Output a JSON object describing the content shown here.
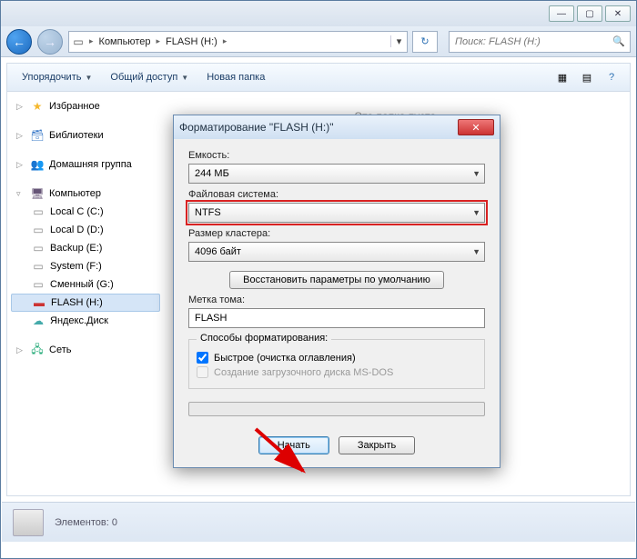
{
  "addressbar": {
    "crumb1": "Компьютер",
    "crumb2": "FLASH (H:)"
  },
  "search": {
    "placeholder": "Поиск: FLASH (H:)"
  },
  "toolbar": {
    "organize": "Упорядочить",
    "share": "Общий доступ",
    "newfolder": "Новая папка"
  },
  "sidebar": {
    "favorites": "Избранное",
    "libraries": "Библиотеки",
    "homegroup": "Домашняя группа",
    "computer": "Компьютер",
    "drives": [
      "Local C (C:)",
      "Local D (D:)",
      "Backup (E:)",
      "System (F:)",
      "Сменный (G:)",
      "FLASH (H:)",
      "Яндекс.Диск"
    ],
    "network": "Сеть"
  },
  "content": {
    "empty": "Эта папка пуста."
  },
  "status": {
    "elements": "Элементов: 0"
  },
  "dialog": {
    "title": "Форматирование \"FLASH (H:)\"",
    "capacity_label": "Емкость:",
    "capacity_value": "244 МБ",
    "fs_label": "Файловая система:",
    "fs_value": "NTFS",
    "cluster_label": "Размер кластера:",
    "cluster_value": "4096 байт",
    "restore": "Восстановить параметры по умолчанию",
    "volume_label": "Метка тома:",
    "volume_value": "FLASH",
    "options_label": "Способы форматирования:",
    "quick": "Быстрое (очистка оглавления)",
    "msdos": "Создание загрузочного диска MS-DOS",
    "start": "Начать",
    "close": "Закрыть"
  }
}
